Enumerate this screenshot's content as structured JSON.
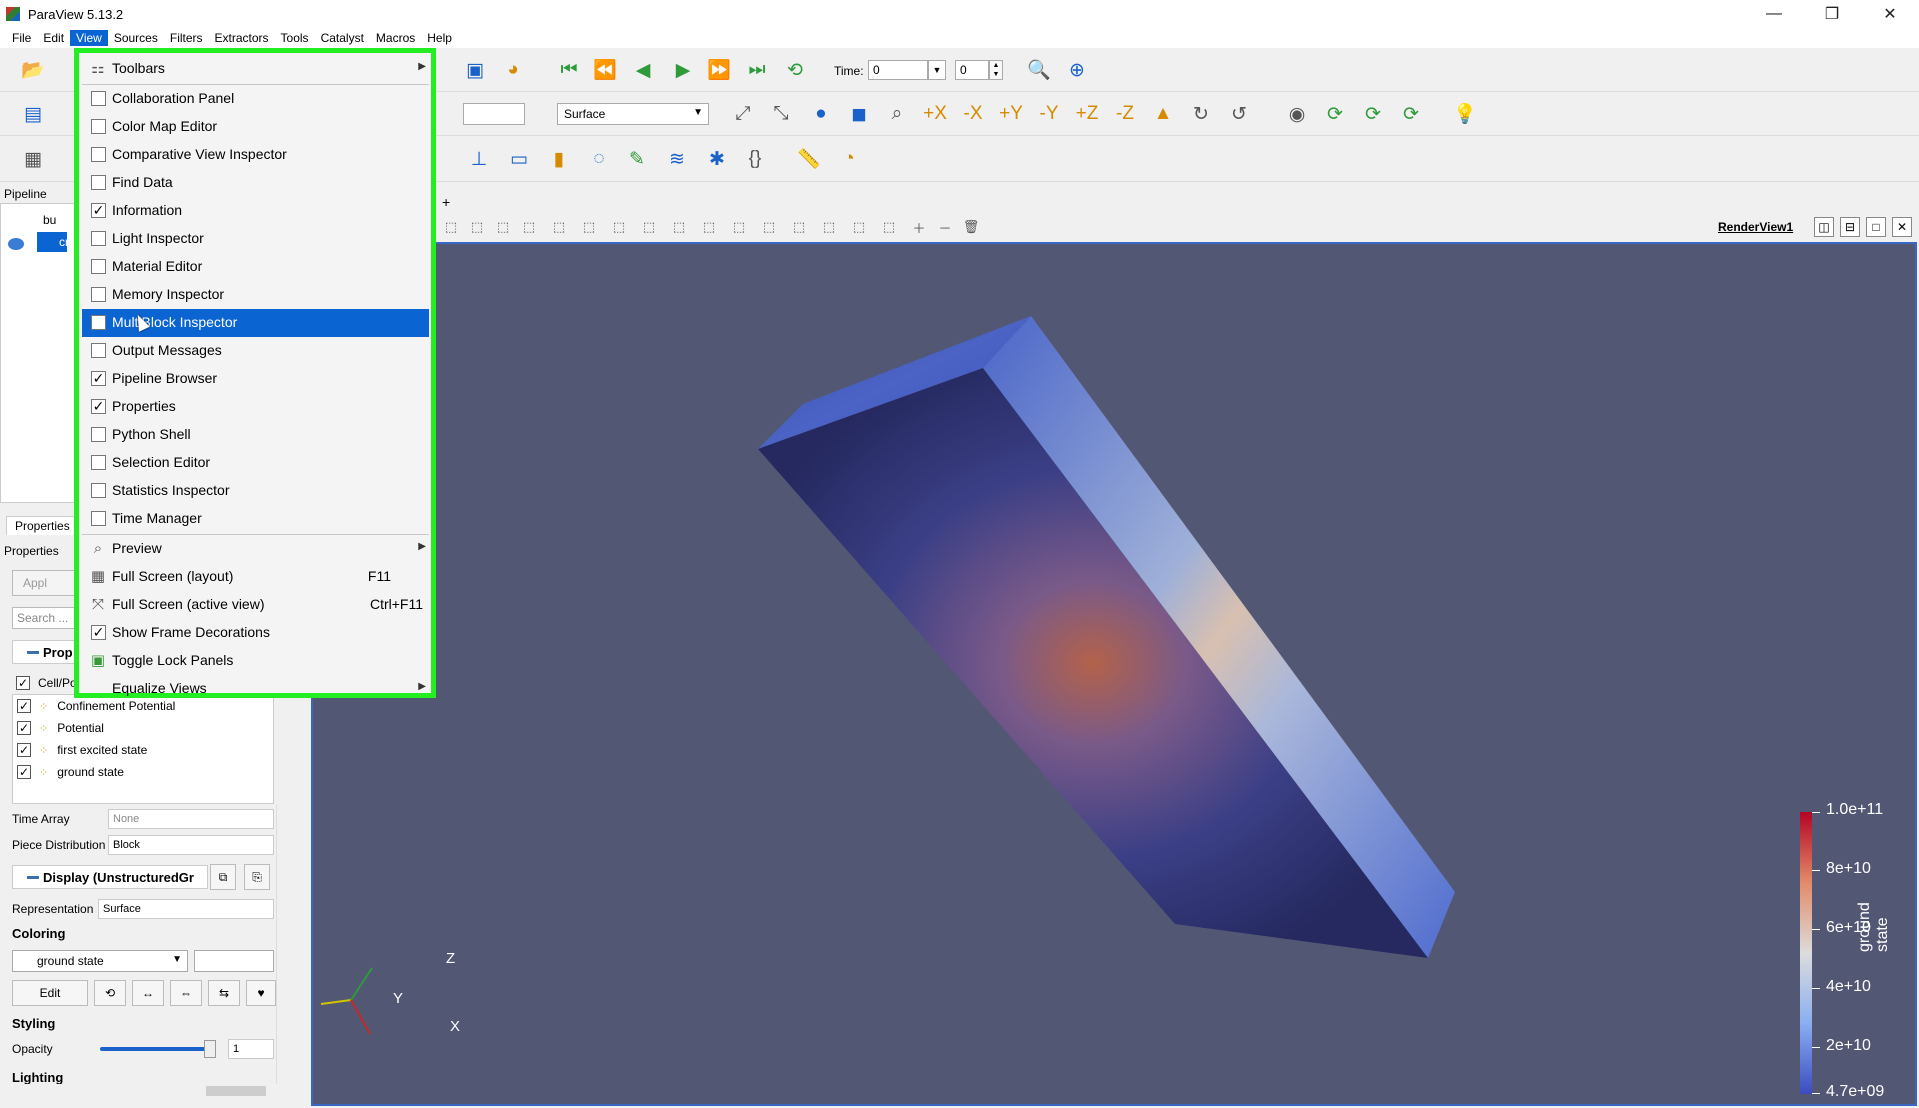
{
  "window": {
    "title": "ParaView 5.13.2",
    "minimize": "—",
    "restore": "❐",
    "close": "✕"
  },
  "menubar": [
    "File",
    "Edit",
    "View",
    "Sources",
    "Filters",
    "Extractors",
    "Tools",
    "Catalyst",
    "Macros",
    "Help"
  ],
  "toolbar": {
    "time_label": "Time:",
    "time_value": "0",
    "timestep_value": "0",
    "representation": "Surface",
    "empty_combo": ""
  },
  "pipeline": {
    "header": "Pipeline Brov",
    "items": [
      {
        "label": "bu"
      },
      {
        "label": "cr"
      }
    ]
  },
  "properties": {
    "tab_label": "Properties",
    "header": "Properties",
    "apply_label": "Appl",
    "search_placeholder": "Search ...",
    "section_properties": "Prop",
    "cell_point_header": "Cell/Po",
    "arrays": [
      {
        "label": "Confinement Potential",
        "checked": "✓"
      },
      {
        "label": "Potential",
        "checked": "✓"
      },
      {
        "label": "first excited state",
        "checked": "✓"
      },
      {
        "label": "ground state",
        "checked": "✓"
      }
    ],
    "time_array_label": "Time Array",
    "time_array_value": "None",
    "piece_distribution_label": "Piece Distribution",
    "piece_distribution_value": "Block",
    "display_section": "Display (UnstructuredGr",
    "representation_label": "Representation",
    "representation_value": "Surface",
    "coloring_label": "Coloring",
    "coloring_value": "ground state",
    "edit_label": "Edit",
    "styling_label": "Styling",
    "opacity_label": "Opacity",
    "opacity_value": "1",
    "opacity_level": 1.0,
    "lighting_label": "Lighting"
  },
  "render_view": {
    "label": "RenderView1",
    "add_tab": "+",
    "background_color": "#525774",
    "colorbar": {
      "title": "ground state",
      "labels": [
        "1.0e+11",
        "8e+10",
        "6e+10",
        "4e+10",
        "2e+10",
        "4.7e+09"
      ]
    },
    "axes": {
      "x": "X",
      "y": "Y",
      "z": "Z"
    }
  },
  "view_menu": {
    "items": [
      {
        "label": "Toolbars",
        "kind": "submenu",
        "icon": "toolbars-icon"
      },
      {
        "label": "Collaboration Panel",
        "kind": "check",
        "checked": ""
      },
      {
        "label": "Color Map Editor",
        "kind": "check",
        "checked": ""
      },
      {
        "label": "Comparative View Inspector",
        "kind": "check",
        "checked": ""
      },
      {
        "label": "Find Data",
        "kind": "check",
        "checked": ""
      },
      {
        "label": "Information",
        "kind": "check",
        "checked": "✓"
      },
      {
        "label": "Light Inspector",
        "kind": "check",
        "checked": ""
      },
      {
        "label": "Material Editor",
        "kind": "check",
        "checked": ""
      },
      {
        "label": "Memory Inspector",
        "kind": "check",
        "checked": ""
      },
      {
        "label": "MultiBlock Inspector",
        "kind": "check",
        "checked": "",
        "highlighted": true
      },
      {
        "label": "Output Messages",
        "kind": "check",
        "checked": ""
      },
      {
        "label": "Pipeline Browser",
        "kind": "check",
        "checked": "✓"
      },
      {
        "label": "Properties",
        "kind": "check",
        "checked": "✓"
      },
      {
        "label": "Python Shell",
        "kind": "check",
        "checked": ""
      },
      {
        "label": "Selection Editor",
        "kind": "check",
        "checked": ""
      },
      {
        "label": "Statistics Inspector",
        "kind": "check",
        "checked": ""
      },
      {
        "label": "Time Manager",
        "kind": "check",
        "checked": ""
      },
      {
        "label": "Preview",
        "kind": "submenu",
        "icon": "preview-icon"
      },
      {
        "label": "Full Screen (layout)",
        "kind": "action",
        "shortcut": "F11",
        "icon": "fullscreen-layout-icon"
      },
      {
        "label": "Full Screen (active view)",
        "kind": "action",
        "shortcut": "Ctrl+F11",
        "icon": "fullscreen-view-icon"
      },
      {
        "label": "Show Frame Decorations",
        "kind": "check",
        "checked": "✓"
      },
      {
        "label": "Toggle Lock Panels",
        "kind": "action",
        "icon": "lock-panels-icon"
      },
      {
        "label": "Equalize Views",
        "kind": "submenu"
      }
    ],
    "submenu_arrow": "▶",
    "highlight_color": "#0a64d2",
    "border_color": "#22ee22"
  }
}
